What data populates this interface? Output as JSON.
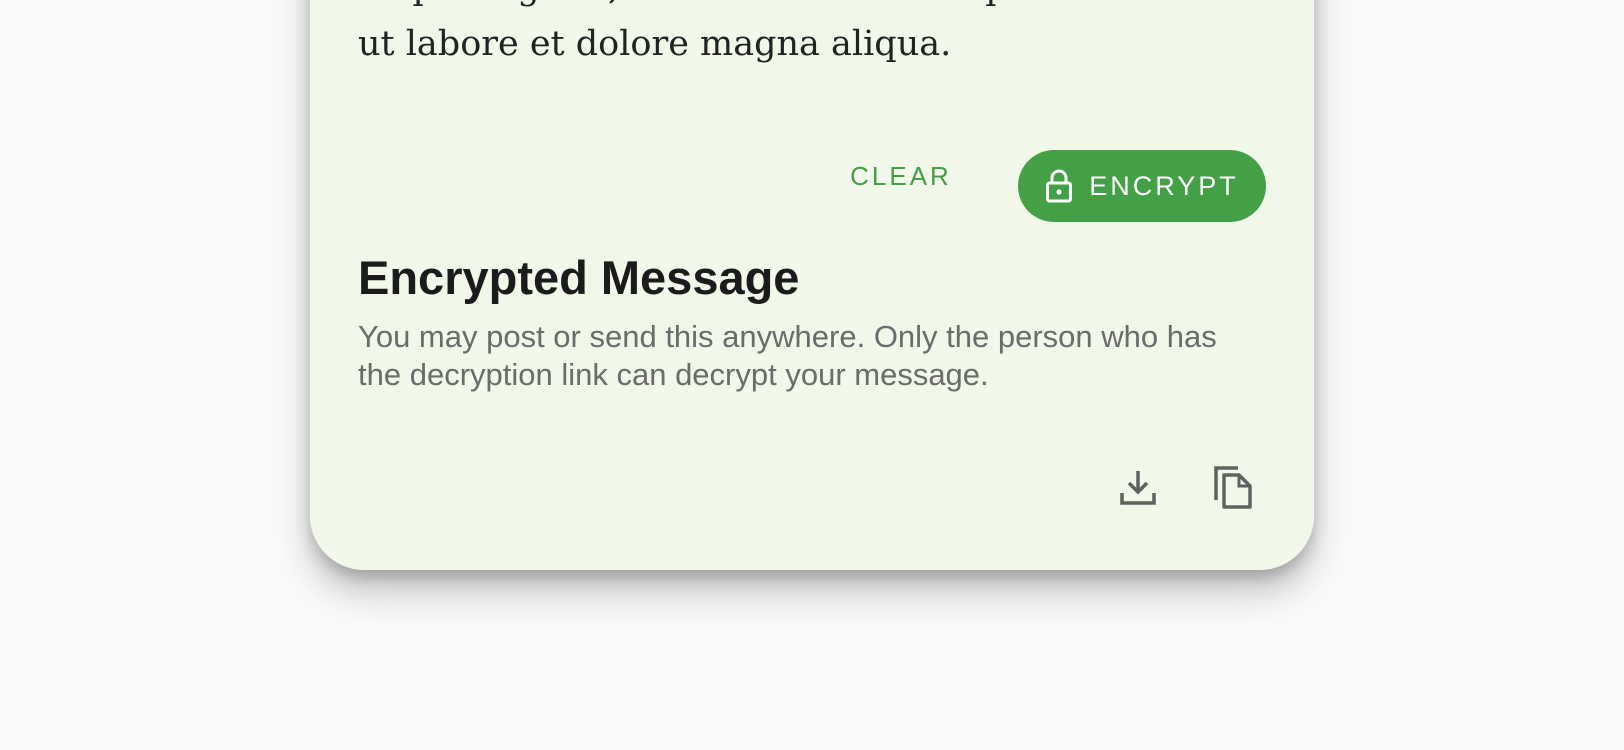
{
  "message": {
    "input_text_tail": "ut labore et dolore magna aliqua."
  },
  "actions": {
    "clear_label": "CLEAR",
    "encrypt_label": "ENCRYPT",
    "encrypt_icon": "lock-icon"
  },
  "encrypted": {
    "title": "Encrypted Message",
    "description": "You may post or send this anywhere. Only the person who has the decryption link can decrypt your message.",
    "download_icon": "download-icon",
    "copy_icon": "copy-icon"
  },
  "colors": {
    "accent": "#43a047",
    "card_background": "#f1f7e9",
    "page_background": "#fafafa",
    "icon_gray": "#616161"
  }
}
